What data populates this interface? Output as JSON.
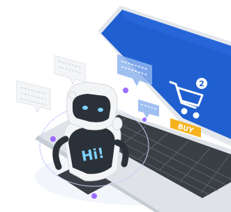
{
  "illustration": {
    "robot_badge": "Hi!",
    "robot_screen_text": "",
    "laptop_screen": {
      "cart_item_count": "2",
      "buy_button": "BUY"
    }
  },
  "colors": {
    "screen_blue": "#1f5fd0",
    "screen_blue_dark": "#174aa8",
    "buy_yellow": "#f6b21d",
    "accent_purple": "#9b6bff",
    "robot_body": "#f3f4f6",
    "robot_dark": "#2b3138",
    "laptop_grey": "#d9dde2",
    "key_dark": "#3a3f45"
  },
  "icons": [
    "shopping-cart-icon",
    "chat-bubble-icon",
    "robot-icon"
  ]
}
